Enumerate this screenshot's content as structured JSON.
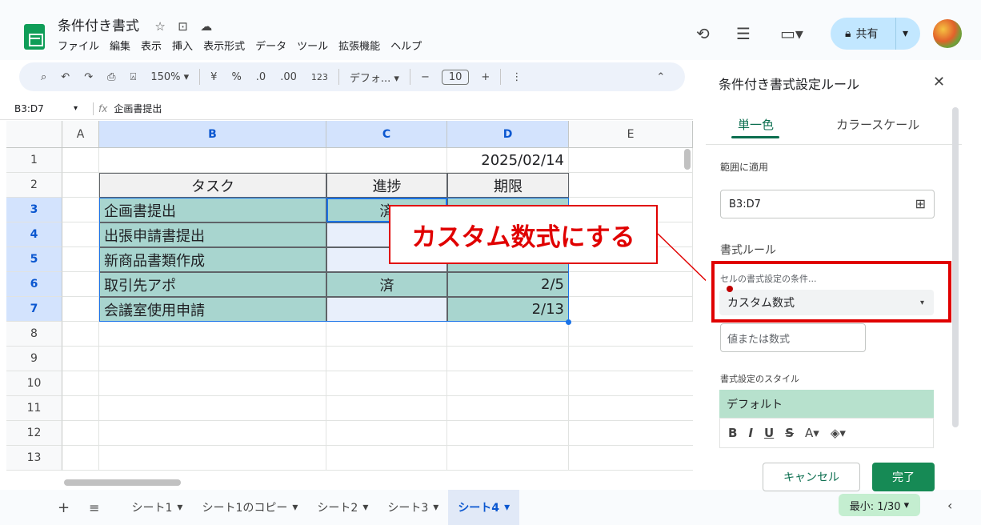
{
  "doc": {
    "title": "条件付き書式",
    "menu": [
      "ファイル",
      "編集",
      "表示",
      "挿入",
      "表示形式",
      "データ",
      "ツール",
      "拡張機能",
      "ヘルプ"
    ]
  },
  "header": {
    "share_label": "共有"
  },
  "toolbar": {
    "zoom": "150%",
    "currency": "¥",
    "percent": "%",
    "dec_decrease": ".0",
    "dec_increase": ".00",
    "number_format": "123",
    "font": "デフォ...",
    "font_size": "10"
  },
  "formula_bar": {
    "name_box": "B3:D7",
    "formula": "企画書提出"
  },
  "grid": {
    "columns": [
      "A",
      "B",
      "C",
      "D",
      "E"
    ],
    "rows": [
      "1",
      "2",
      "3",
      "4",
      "5",
      "6",
      "7",
      "8",
      "9",
      "10",
      "11",
      "12",
      "13"
    ],
    "cells": {
      "d1": "2025/02/14",
      "b2": "タスク",
      "c2": "進捗",
      "d2": "期限",
      "b3": "企画書提出",
      "c3": "済",
      "b4": "出張申請書提出",
      "b5": "新商品書類作成",
      "b6": "取引先アポ",
      "c6": "済",
      "d6": "2/5",
      "b7": "会議室使用申請",
      "d7": "2/13"
    }
  },
  "annotation": {
    "text": "カスタム数式にする",
    "color": "#e00000"
  },
  "sheet_tabs": [
    "シート1",
    "シート1のコピー",
    "シート2",
    "シート3",
    "シート4"
  ],
  "status": {
    "explore": "最小: 1/30"
  },
  "panel": {
    "title": "条件付き書式設定ルール",
    "tab_single": "単一色",
    "tab_color_scale": "カラースケール",
    "range_label": "範囲に適用",
    "range_value": "B3:D7",
    "rules_label": "書式ルール",
    "condition_label": "セルの書式設定の条件...",
    "condition_value": "カスタム数式",
    "value_placeholder": "値または数式",
    "style_label": "書式設定のスタイル",
    "style_preview": "デフォルト",
    "cancel": "キャンセル",
    "done": "完了"
  }
}
